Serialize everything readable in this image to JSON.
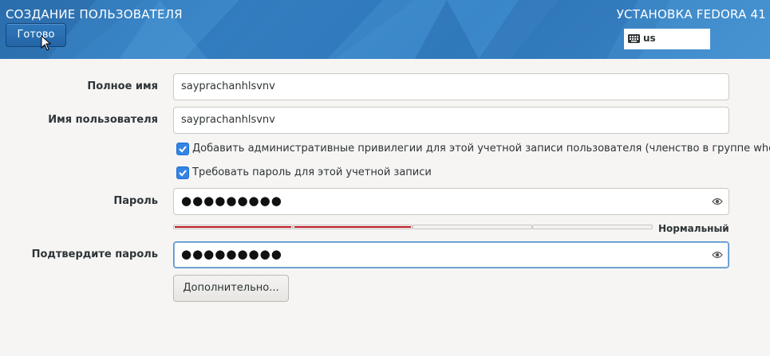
{
  "header": {
    "title": "СОЗДАНИЕ ПОЛЬЗОВАТЕЛЯ",
    "product": "УСТАНОВКА FEDORA 41",
    "done_label": "Готово",
    "keyboard_layout": "us"
  },
  "form": {
    "full_name": {
      "label": "Полное имя",
      "value": "sayprachanhlsvnv"
    },
    "username": {
      "label": "Имя пользователя",
      "value": "sayprachanhlsvnv"
    },
    "admin_checkbox": {
      "label": "Добавить административные привилегии для этой учетной записи пользователя (членство в группе wheel)",
      "checked": true
    },
    "require_password_checkbox": {
      "label": "Требовать пароль для этой учетной записи",
      "checked": true
    },
    "password": {
      "label": "Пароль",
      "masked_value": "●●●●●●●●●"
    },
    "strength": {
      "label": "Нормальный",
      "filled_segments": 2,
      "total_segments": 4,
      "color": "#c01c28"
    },
    "confirm_password": {
      "label": "Подтвердите пароль",
      "masked_value": "●●●●●●●●●"
    },
    "advanced_button": "Дополнительно..."
  },
  "icons": {
    "keyboard": "keyboard-icon",
    "eye": "eye-icon",
    "check": "checkmark-icon",
    "cursor": "mouse-pointer-icon"
  }
}
